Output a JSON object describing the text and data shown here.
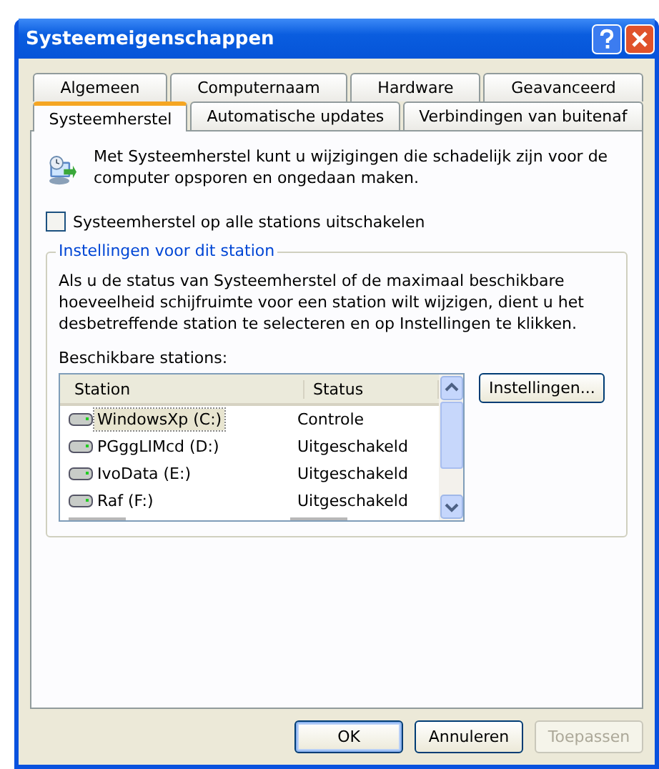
{
  "window": {
    "title": "Systeemeigenschappen"
  },
  "tab_rows": [
    [
      {
        "label": "Algemeen",
        "selected": false
      },
      {
        "label": "Computernaam",
        "selected": false
      },
      {
        "label": "Hardware",
        "selected": false
      },
      {
        "label": "Geavanceerd",
        "selected": false
      }
    ],
    [
      {
        "label": "Systeemherstel",
        "selected": true
      },
      {
        "label": "Automatische updates",
        "selected": false
      },
      {
        "label": "Verbindingen van buitenaf",
        "selected": false
      }
    ]
  ],
  "intro": "Met Systeemherstel kunt u wijzigingen die schadelijk zijn voor de computer opsporen en ongedaan maken.",
  "disable_all": {
    "label": "Systeemherstel op alle stations uitschakelen",
    "checked": false
  },
  "group": {
    "title": "Instellingen voor dit station",
    "description": "Als u de status van Systeemherstel of de maximaal beschikbare hoeveelheid schijfruimte voor een station wilt wijzigen, dient u het desbetreffende station te selecteren en op Instellingen te klikken.",
    "list_label": "Beschikbare stations:",
    "columns": [
      "Station",
      "Status"
    ],
    "rows": [
      {
        "station": "WindowsXp (C:)",
        "status": "Controle",
        "selected": true
      },
      {
        "station": "PGggLIMcd (D:)",
        "status": "Uitgeschakeld",
        "selected": false
      },
      {
        "station": "IvoData (E:)",
        "status": "Uitgeschakeld",
        "selected": false
      },
      {
        "station": "Raf (F:)",
        "status": "Uitgeschakeld",
        "selected": false
      }
    ],
    "settings_button": "Instellingen..."
  },
  "buttons": [
    {
      "label": "OK",
      "default": true,
      "disabled": false
    },
    {
      "label": "Annuleren",
      "default": false,
      "disabled": false
    },
    {
      "label": "Toepassen",
      "default": false,
      "disabled": true
    }
  ]
}
